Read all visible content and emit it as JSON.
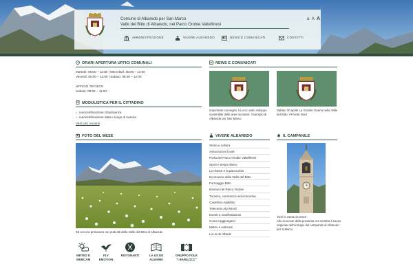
{
  "header": {
    "site_name": "Comune di Albaredo per San Marco",
    "site_subtitle": "Valle del Bitto di Albaredo, nel Parco Orobie Valtellinesi",
    "font_size_small": "A",
    "font_size_large": "A",
    "font_size_prefix": "a",
    "nav": [
      {
        "label": "AMMINISTRAZIONE",
        "icon": "building-icon"
      },
      {
        "label": "VIVERE ALBAREDO",
        "icon": "church-icon"
      },
      {
        "label": "NEWS E COMUNICATI",
        "icon": "newspaper-icon"
      },
      {
        "label": "CONTATTI",
        "icon": "envelope-icon"
      }
    ]
  },
  "orari": {
    "title": "ORARI APERTURA UFFICI COMUNALI",
    "lines": [
      "Martedì: 08:00 – 12:00 | Mercoledì: 08:00 – 12:00",
      "Venerdì: 08:00 – 12:00 | Sabato: 08:00 – 12:00"
    ],
    "tecnico_title": "UFFICIO TECNICO",
    "tecnico_hours": "Sabato: 09:00 – 11:00"
  },
  "modulistica": {
    "title": "MODULISTICA PER IL CITTADINO",
    "items": [
      "Autocertificazione cittadinanza",
      "Autocertificazione data e luogo di nascita"
    ],
    "all_link": "Vedi tutti i moduli"
  },
  "news": {
    "title": "NEWS E COMUNICATI",
    "items": [
      {
        "caption": "Importante convegno a Lecco sullo sviluppo sostenibile delle aree montane: l'esempio di Albaredo per San Marco"
      },
      {
        "caption": "Sabato 30 aprile La Grande Guerra nella Valle del Bitto: il Fronte Nord"
      }
    ]
  },
  "foto": {
    "title": "FOTO DEL MESE",
    "caption": "Ed ecco la primavera nei prati alti della Valle del Bitto di Albaredo"
  },
  "vivere": {
    "title": "VIVERE ALBAREDO",
    "items": [
      "Storia e cultura",
      "Associazioni locali",
      "Porta del Parco Orobie Valtellinesi",
      "Sport e tempo libero",
      "Le chiese e la parrocchia",
      "Ecomuseo della Valle del Bitto",
      "Formaggio Bitto",
      "Itinerari nel Parco Orobie",
      "Turismo, commercio ed economia",
      "Caseificio Alpiblitto",
      "Telecento Alpi Word",
      "Eventi e manifestazioni",
      "Come raggiungerci",
      "Meteo e webcam",
      "La us de Albarei"
    ]
  },
  "campanile": {
    "title": "IL CAMPANILE",
    "heading": "Tieni le casse accese!!",
    "text": "Allo scoccare della prossima ora sembra il suono originale dell'orologio del campanile di Albaredo per S.Marco"
  },
  "quick_links": [
    {
      "label": "METEO E\nWEBCAM",
      "icon": "weather-icon"
    },
    {
      "label": "FLY\nEMOTION",
      "icon": "bird-icon"
    },
    {
      "label": "RISTORANTI",
      "icon": "restaurant-icon"
    },
    {
      "label": "LA US DE\nALBAREI",
      "icon": "book-icon"
    },
    {
      "label": "GRUPPO FOLK\n\"I BARILOCC\"",
      "icon": "accordion-icon"
    }
  ],
  "colors": {
    "accent": "#2f4f3c",
    "news_tile": "#5f8f6e",
    "sky": "#5a8fc7"
  }
}
